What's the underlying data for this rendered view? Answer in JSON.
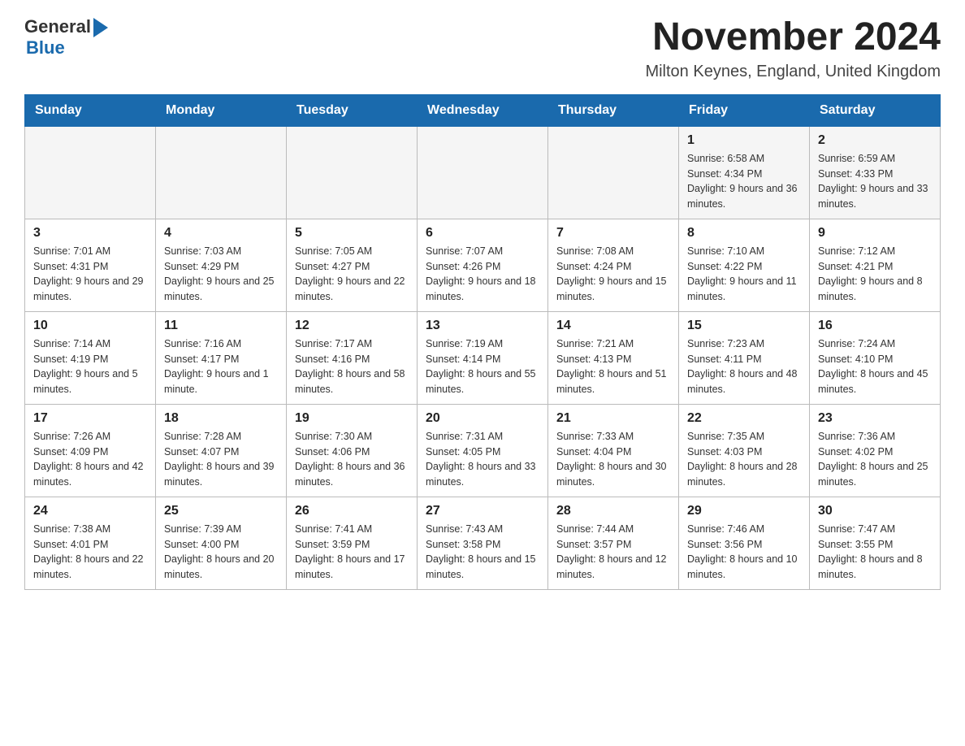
{
  "header": {
    "logo_general": "General",
    "logo_blue": "Blue",
    "month_title": "November 2024",
    "location": "Milton Keynes, England, United Kingdom"
  },
  "weekdays": [
    "Sunday",
    "Monday",
    "Tuesday",
    "Wednesday",
    "Thursday",
    "Friday",
    "Saturday"
  ],
  "rows": [
    {
      "cells": [
        {
          "day": "",
          "info": ""
        },
        {
          "day": "",
          "info": ""
        },
        {
          "day": "",
          "info": ""
        },
        {
          "day": "",
          "info": ""
        },
        {
          "day": "",
          "info": ""
        },
        {
          "day": "1",
          "info": "Sunrise: 6:58 AM\nSunset: 4:34 PM\nDaylight: 9 hours and 36 minutes."
        },
        {
          "day": "2",
          "info": "Sunrise: 6:59 AM\nSunset: 4:33 PM\nDaylight: 9 hours and 33 minutes."
        }
      ]
    },
    {
      "cells": [
        {
          "day": "3",
          "info": "Sunrise: 7:01 AM\nSunset: 4:31 PM\nDaylight: 9 hours and 29 minutes."
        },
        {
          "day": "4",
          "info": "Sunrise: 7:03 AM\nSunset: 4:29 PM\nDaylight: 9 hours and 25 minutes."
        },
        {
          "day": "5",
          "info": "Sunrise: 7:05 AM\nSunset: 4:27 PM\nDaylight: 9 hours and 22 minutes."
        },
        {
          "day": "6",
          "info": "Sunrise: 7:07 AM\nSunset: 4:26 PM\nDaylight: 9 hours and 18 minutes."
        },
        {
          "day": "7",
          "info": "Sunrise: 7:08 AM\nSunset: 4:24 PM\nDaylight: 9 hours and 15 minutes."
        },
        {
          "day": "8",
          "info": "Sunrise: 7:10 AM\nSunset: 4:22 PM\nDaylight: 9 hours and 11 minutes."
        },
        {
          "day": "9",
          "info": "Sunrise: 7:12 AM\nSunset: 4:21 PM\nDaylight: 9 hours and 8 minutes."
        }
      ]
    },
    {
      "cells": [
        {
          "day": "10",
          "info": "Sunrise: 7:14 AM\nSunset: 4:19 PM\nDaylight: 9 hours and 5 minutes."
        },
        {
          "day": "11",
          "info": "Sunrise: 7:16 AM\nSunset: 4:17 PM\nDaylight: 9 hours and 1 minute."
        },
        {
          "day": "12",
          "info": "Sunrise: 7:17 AM\nSunset: 4:16 PM\nDaylight: 8 hours and 58 minutes."
        },
        {
          "day": "13",
          "info": "Sunrise: 7:19 AM\nSunset: 4:14 PM\nDaylight: 8 hours and 55 minutes."
        },
        {
          "day": "14",
          "info": "Sunrise: 7:21 AM\nSunset: 4:13 PM\nDaylight: 8 hours and 51 minutes."
        },
        {
          "day": "15",
          "info": "Sunrise: 7:23 AM\nSunset: 4:11 PM\nDaylight: 8 hours and 48 minutes."
        },
        {
          "day": "16",
          "info": "Sunrise: 7:24 AM\nSunset: 4:10 PM\nDaylight: 8 hours and 45 minutes."
        }
      ]
    },
    {
      "cells": [
        {
          "day": "17",
          "info": "Sunrise: 7:26 AM\nSunset: 4:09 PM\nDaylight: 8 hours and 42 minutes."
        },
        {
          "day": "18",
          "info": "Sunrise: 7:28 AM\nSunset: 4:07 PM\nDaylight: 8 hours and 39 minutes."
        },
        {
          "day": "19",
          "info": "Sunrise: 7:30 AM\nSunset: 4:06 PM\nDaylight: 8 hours and 36 minutes."
        },
        {
          "day": "20",
          "info": "Sunrise: 7:31 AM\nSunset: 4:05 PM\nDaylight: 8 hours and 33 minutes."
        },
        {
          "day": "21",
          "info": "Sunrise: 7:33 AM\nSunset: 4:04 PM\nDaylight: 8 hours and 30 minutes."
        },
        {
          "day": "22",
          "info": "Sunrise: 7:35 AM\nSunset: 4:03 PM\nDaylight: 8 hours and 28 minutes."
        },
        {
          "day": "23",
          "info": "Sunrise: 7:36 AM\nSunset: 4:02 PM\nDaylight: 8 hours and 25 minutes."
        }
      ]
    },
    {
      "cells": [
        {
          "day": "24",
          "info": "Sunrise: 7:38 AM\nSunset: 4:01 PM\nDaylight: 8 hours and 22 minutes."
        },
        {
          "day": "25",
          "info": "Sunrise: 7:39 AM\nSunset: 4:00 PM\nDaylight: 8 hours and 20 minutes."
        },
        {
          "day": "26",
          "info": "Sunrise: 7:41 AM\nSunset: 3:59 PM\nDaylight: 8 hours and 17 minutes."
        },
        {
          "day": "27",
          "info": "Sunrise: 7:43 AM\nSunset: 3:58 PM\nDaylight: 8 hours and 15 minutes."
        },
        {
          "day": "28",
          "info": "Sunrise: 7:44 AM\nSunset: 3:57 PM\nDaylight: 8 hours and 12 minutes."
        },
        {
          "day": "29",
          "info": "Sunrise: 7:46 AM\nSunset: 3:56 PM\nDaylight: 8 hours and 10 minutes."
        },
        {
          "day": "30",
          "info": "Sunrise: 7:47 AM\nSunset: 3:55 PM\nDaylight: 8 hours and 8 minutes."
        }
      ]
    }
  ]
}
